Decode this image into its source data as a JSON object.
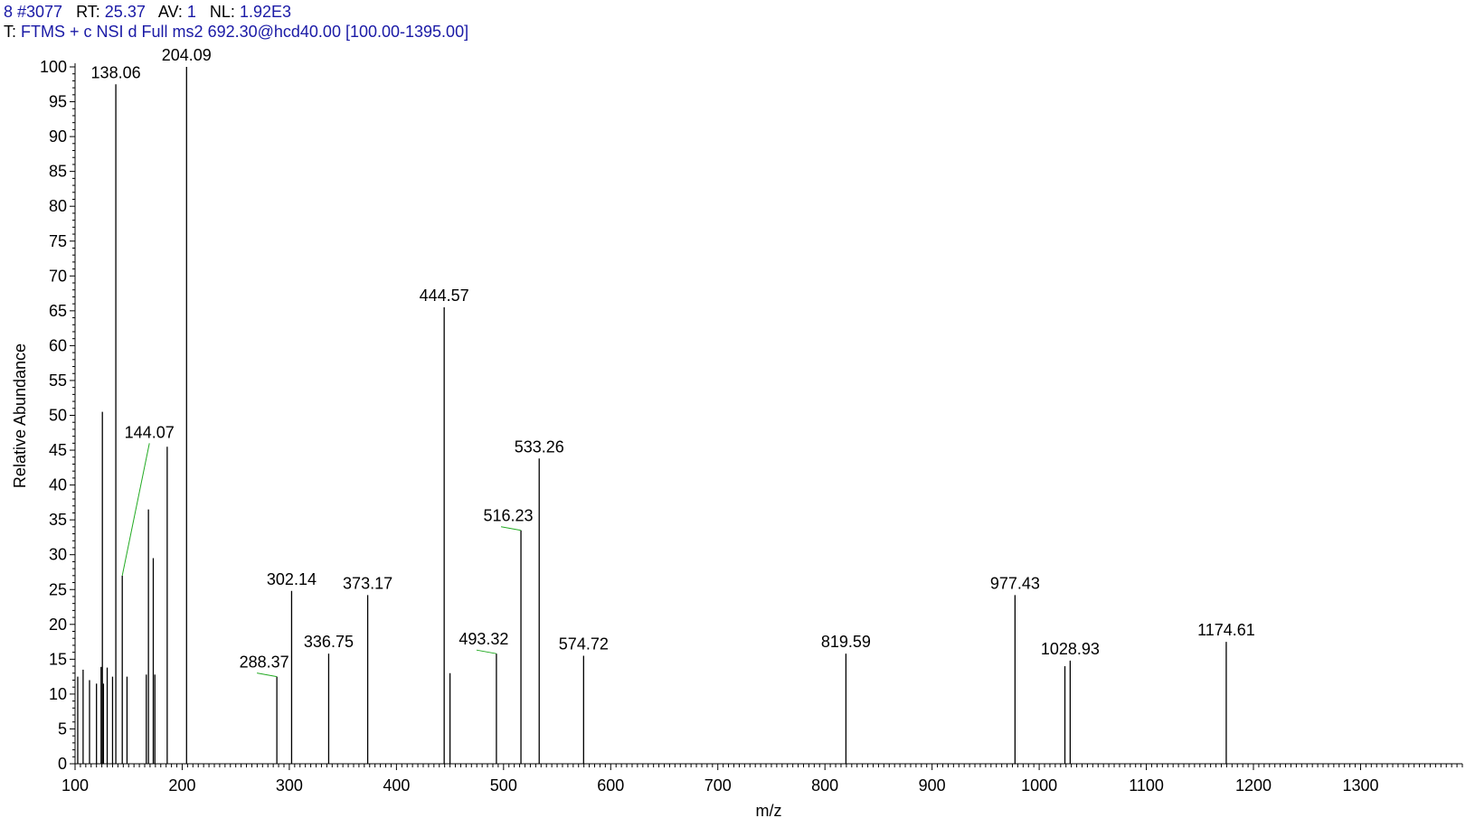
{
  "header": {
    "scan": "8 #3077",
    "rt_label": "RT:",
    "rt_value": "25.37",
    "av_label": "AV:",
    "av_value": "1",
    "nl_label": "NL:",
    "nl_value": "1.92E3",
    "filter_label": "T:",
    "filter_value": "FTMS + c NSI d Full ms2 692.30@hcd40.00 [100.00-1395.00]"
  },
  "colors": {
    "axis": "#000000",
    "peak": "#000000",
    "header_value": "#1a1aa6",
    "leader": "#22aa22"
  },
  "chart_data": {
    "type": "bar",
    "xlabel": "m/z",
    "ylabel": "Relative Abundance",
    "xlim": [
      100,
      1395
    ],
    "ylim": [
      0,
      100
    ],
    "x_ticks": [
      100,
      200,
      300,
      400,
      500,
      600,
      700,
      800,
      900,
      1000,
      1100,
      1200,
      1300
    ],
    "y_ticks": [
      0,
      5,
      10,
      15,
      20,
      25,
      30,
      35,
      40,
      45,
      50,
      55,
      60,
      65,
      70,
      75,
      80,
      85,
      90,
      95,
      100
    ],
    "peaks": [
      {
        "mz": 102.5,
        "intensity": 12.5
      },
      {
        "mz": 107.5,
        "intensity": 13.5
      },
      {
        "mz": 113.5,
        "intensity": 12.0
      },
      {
        "mz": 120.0,
        "intensity": 11.5
      },
      {
        "mz": 124.3,
        "intensity": 13.9
      },
      {
        "mz": 125.5,
        "intensity": 50.5
      },
      {
        "mz": 126.5,
        "intensity": 11.5
      },
      {
        "mz": 130.0,
        "intensity": 13.8
      },
      {
        "mz": 135.0,
        "intensity": 12.5
      },
      {
        "mz": 138.06,
        "intensity": 97.5,
        "label": "138.06"
      },
      {
        "mz": 144.07,
        "intensity": 27.0,
        "label": "144.07",
        "leader": true
      },
      {
        "mz": 148.5,
        "intensity": 12.5
      },
      {
        "mz": 166.5,
        "intensity": 12.8
      },
      {
        "mz": 168.5,
        "intensity": 36.5
      },
      {
        "mz": 173.0,
        "intensity": 29.5
      },
      {
        "mz": 174.5,
        "intensity": 12.8
      },
      {
        "mz": 186.0,
        "intensity": 45.5
      },
      {
        "mz": 204.09,
        "intensity": 100.0,
        "label": "204.09"
      },
      {
        "mz": 288.37,
        "intensity": 12.5,
        "label": "288.37",
        "leader": true
      },
      {
        "mz": 302.14,
        "intensity": 24.8,
        "label": "302.14"
      },
      {
        "mz": 336.75,
        "intensity": 15.8,
        "label": "336.75"
      },
      {
        "mz": 373.17,
        "intensity": 24.2,
        "label": "373.17"
      },
      {
        "mz": 444.57,
        "intensity": 65.5,
        "label": "444.57"
      },
      {
        "mz": 450.0,
        "intensity": 13.0
      },
      {
        "mz": 493.32,
        "intensity": 15.8,
        "label": "493.32",
        "leader": true
      },
      {
        "mz": 516.23,
        "intensity": 33.5,
        "label": "516.23",
        "leader": true
      },
      {
        "mz": 533.26,
        "intensity": 43.8,
        "label": "533.26"
      },
      {
        "mz": 574.72,
        "intensity": 15.5,
        "label": "574.72"
      },
      {
        "mz": 819.59,
        "intensity": 15.8,
        "label": "819.59"
      },
      {
        "mz": 977.43,
        "intensity": 24.2,
        "label": "977.43"
      },
      {
        "mz": 1024.0,
        "intensity": 14.0
      },
      {
        "mz": 1028.93,
        "intensity": 14.8,
        "label": "1028.93"
      },
      {
        "mz": 1174.61,
        "intensity": 17.5,
        "label": "1174.61"
      }
    ]
  }
}
